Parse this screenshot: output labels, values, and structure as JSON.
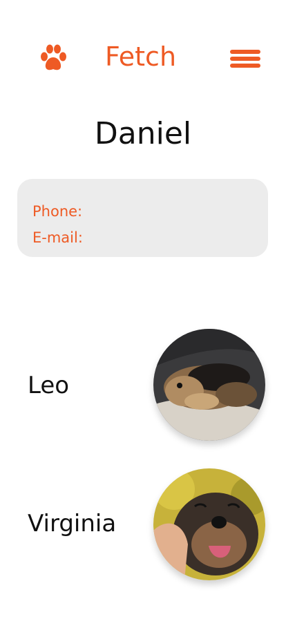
{
  "header": {
    "logo_text": "Fetch",
    "brand_color": "#EE5A24",
    "left_icon": "paw-icon",
    "right_icon": "menu-icon"
  },
  "owner": {
    "name": "Daniel"
  },
  "contact": {
    "phone_label": "Phone:",
    "email_label": "E-mail:"
  },
  "pets": [
    {
      "name": "Leo",
      "photo_icon": "dog-photo"
    },
    {
      "name": "Virginia",
      "photo_icon": "dog-photo"
    }
  ]
}
